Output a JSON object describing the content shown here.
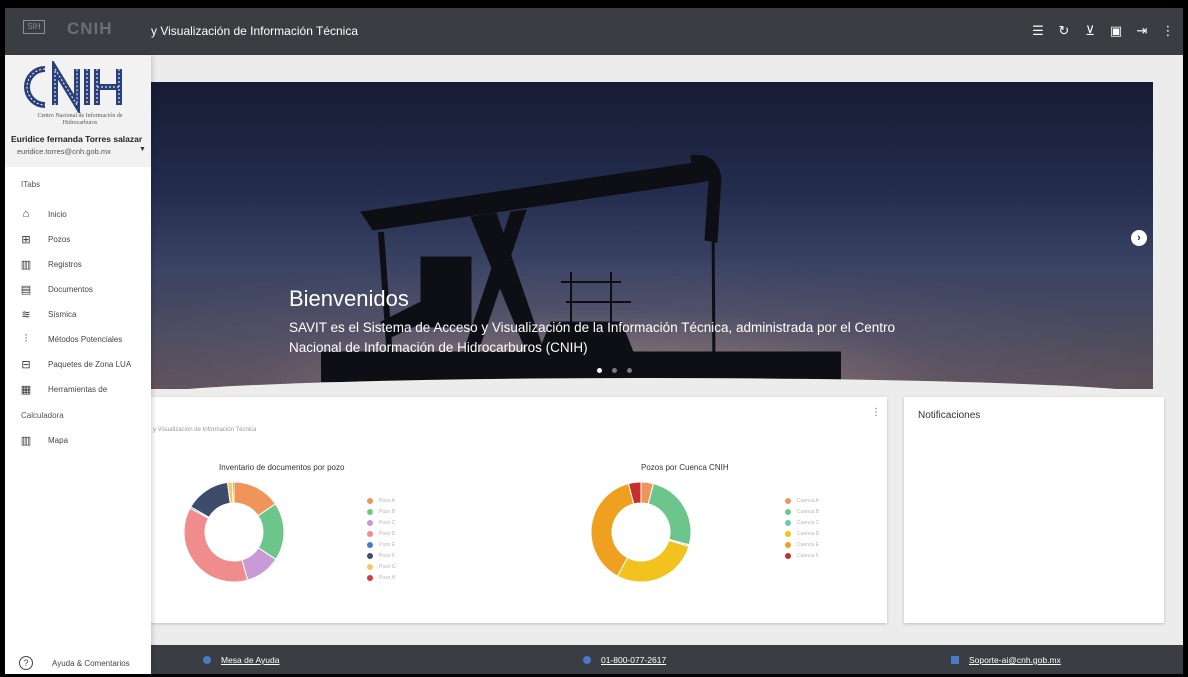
{
  "topbar": {
    "logo_small": "SIH",
    "logo_brand": "CNIH",
    "title": "y Visualización de Información Técnica",
    "icons": [
      "list-icon",
      "refresh-icon",
      "cart-icon",
      "help-book-icon",
      "exit-icon",
      "more-vert-icon"
    ]
  },
  "sidebar": {
    "org_name": "Centro Nacional de Información de Hidrocarburos",
    "user_name": "Euridice fernanda Torres salazar",
    "user_email": "euridice.torres@cnh.gob.mx",
    "section_tabs": "ITabs",
    "items": [
      {
        "label": "Inicio",
        "icon": "home-icon"
      },
      {
        "label": "Pozos",
        "icon": "well-icon"
      },
      {
        "label": "Registros",
        "icon": "records-icon"
      },
      {
        "label": "Documentos",
        "icon": "documents-icon"
      },
      {
        "label": "Sísmica",
        "icon": "seismic-icon"
      },
      {
        "label": "Métodos Potenciales",
        "icon": "methods-icon"
      },
      {
        "label": "Paquetes de Zona LUA",
        "icon": "package-icon"
      },
      {
        "label": "Herramientas de",
        "icon": "tools-icon"
      }
    ],
    "section_calc": "Calculadora",
    "map_item": {
      "label": "Mapa",
      "icon": "map-icon"
    },
    "help_label": "Ayuda & Comentarios"
  },
  "hero": {
    "title": "Bienvenidos",
    "text": "SAVIT es el Sistema de Acceso y Visualización de la Información Técnica, administrada por el Centro Nacional de Información de Hidrocarburos (CNIH)"
  },
  "dashboard": {
    "subtitle": "y Visualización de Información Técnica",
    "menu": "⋮"
  },
  "notifications": {
    "title": "Notificaciones"
  },
  "chart_data": [
    {
      "type": "pie",
      "title": "Inventario de documentos por pozo",
      "donut": true,
      "labels": [
        "Pozo A",
        "Pozo B",
        "Pozo C",
        "Pozo D",
        "Pozo E",
        "Pozo F",
        "Pozo G",
        "Pozo H"
      ],
      "values": [
        15,
        18,
        11,
        36,
        0.5,
        14,
        1.5,
        0.5
      ],
      "colors": [
        "#f0955a",
        "#6cc58a",
        "#c89ad6",
        "#ef8c8c",
        "#4a79c8",
        "#3d4c6a",
        "#f2cd5c",
        "#d43b3b"
      ]
    },
    {
      "type": "pie",
      "title": "Pozos por Cuenca CNIH",
      "donut": true,
      "labels": [
        "Cuenca A",
        "Cuenca B",
        "Cuenca C",
        "Cuenca D",
        "Cuenca E",
        "Cuenca F"
      ],
      "values": [
        4,
        25,
        0.5,
        28,
        38,
        4
      ],
      "colors": [
        "#f0955a",
        "#6cc58a",
        "#6cc5b8",
        "#f2c21e",
        "#f0a020",
        "#c62f2f"
      ]
    }
  ],
  "footer": {
    "help_desk": "Mesa de Ayuda",
    "phone": "01-800-077-2617",
    "email": "Soporte-ai@cnh.gob.mx"
  }
}
